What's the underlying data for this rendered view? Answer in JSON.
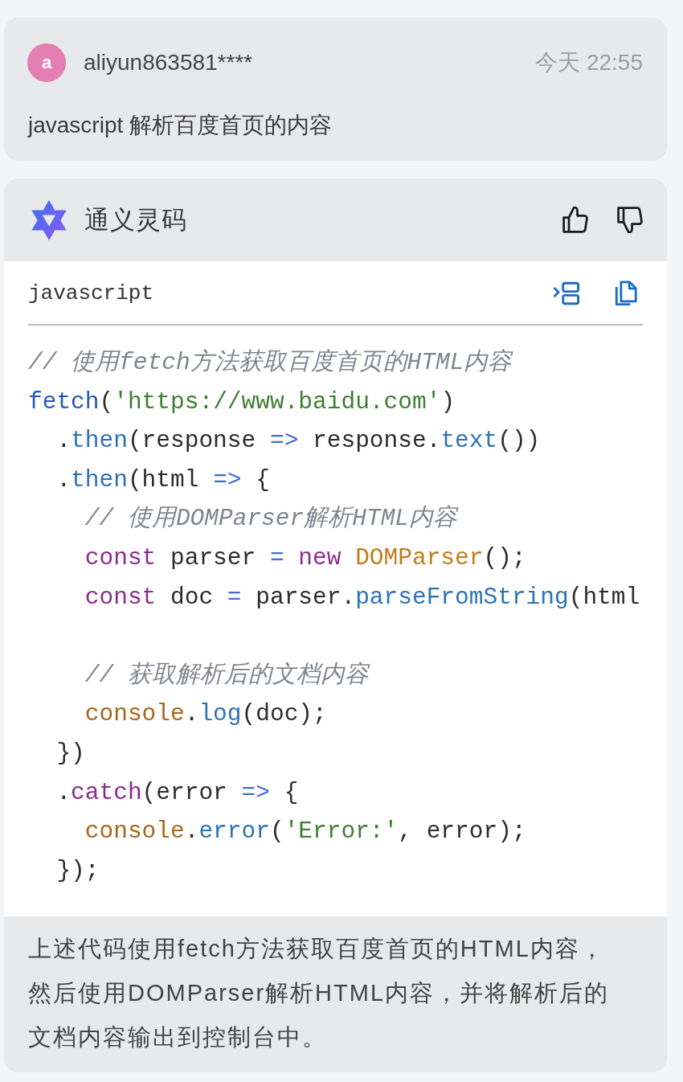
{
  "question": {
    "avatar_letter": "a",
    "username": "aliyun863581****",
    "time": "今天 22:55",
    "text": "javascript 解析百度首页的内容"
  },
  "answer": {
    "assistant_name": "通义灵码",
    "code_block": {
      "language": "javascript",
      "lines": [
        {
          "kind": "code",
          "tokens": [
            {
              "kind": "comment",
              "text": "// 使用fetch方法获取百度首页的HTML内容"
            }
          ]
        },
        {
          "kind": "code",
          "tokens": [
            {
              "kind": "function",
              "text": "fetch"
            },
            {
              "kind": "plain",
              "text": "("
            },
            {
              "kind": "string",
              "text": "'https://www.baidu.com'"
            },
            {
              "kind": "plain",
              "text": ")"
            }
          ],
          "children": [
            {
              "kind": "code",
              "tokens": [
                {
                  "kind": "plain",
                  "text": "."
                },
                {
                  "kind": "method",
                  "text": "then"
                },
                {
                  "kind": "plain",
                  "text": "(response "
                },
                {
                  "kind": "operator",
                  "text": "=>"
                },
                {
                  "kind": "plain",
                  "text": " response."
                },
                {
                  "kind": "method",
                  "text": "text"
                },
                {
                  "kind": "plain",
                  "text": "())"
                }
              ]
            },
            {
              "kind": "code",
              "tokens": [
                {
                  "kind": "plain",
                  "text": "."
                },
                {
                  "kind": "method",
                  "text": "then"
                },
                {
                  "kind": "plain",
                  "text": "(html "
                },
                {
                  "kind": "operator",
                  "text": "=>"
                },
                {
                  "kind": "plain",
                  "text": " {"
                }
              ],
              "children": [
                {
                  "kind": "code",
                  "tokens": [
                    {
                      "kind": "comment",
                      "text": "// 使用DOMParser解析HTML内容"
                    }
                  ]
                },
                {
                  "kind": "code",
                  "tokens": [
                    {
                      "kind": "keyword",
                      "text": "const"
                    },
                    {
                      "kind": "plain",
                      "text": " parser "
                    },
                    {
                      "kind": "operator",
                      "text": "="
                    },
                    {
                      "kind": "keyword",
                      "text": " new"
                    },
                    {
                      "kind": "class",
                      "text": " DOMParser"
                    },
                    {
                      "kind": "plain",
                      "text": "();"
                    }
                  ]
                },
                {
                  "kind": "code",
                  "tokens": [
                    {
                      "kind": "keyword",
                      "text": "const"
                    },
                    {
                      "kind": "plain",
                      "text": " doc "
                    },
                    {
                      "kind": "operator",
                      "text": "="
                    },
                    {
                      "kind": "plain",
                      "text": " parser."
                    },
                    {
                      "kind": "method",
                      "text": "parseFromString"
                    },
                    {
                      "kind": "plain",
                      "text": "(html"
                    }
                  ]
                },
                {
                  "kind": "blank"
                },
                {
                  "kind": "code",
                  "tokens": [
                    {
                      "kind": "comment",
                      "text": "// 获取解析后的文档内容"
                    }
                  ]
                },
                {
                  "kind": "code",
                  "tokens": [
                    {
                      "kind": "object",
                      "text": "console"
                    },
                    {
                      "kind": "plain",
                      "text": "."
                    },
                    {
                      "kind": "method",
                      "text": "log"
                    },
                    {
                      "kind": "plain",
                      "text": "(doc);"
                    }
                  ]
                }
              ]
            },
            {
              "kind": "code",
              "tokens": [
                {
                  "kind": "plain",
                  "text": "})"
                }
              ]
            },
            {
              "kind": "code",
              "tokens": [
                {
                  "kind": "plain",
                  "text": "."
                },
                {
                  "kind": "keyword",
                  "text": "catch"
                },
                {
                  "kind": "plain",
                  "text": "(error "
                },
                {
                  "kind": "operator",
                  "text": "=>"
                },
                {
                  "kind": "plain",
                  "text": " {"
                }
              ],
              "children": [
                {
                  "kind": "code",
                  "tokens": [
                    {
                      "kind": "object",
                      "text": "console"
                    },
                    {
                      "kind": "plain",
                      "text": "."
                    },
                    {
                      "kind": "method",
                      "text": "error"
                    },
                    {
                      "kind": "plain",
                      "text": "("
                    },
                    {
                      "kind": "string",
                      "text": "'Error:'"
                    },
                    {
                      "kind": "plain",
                      "text": ", error);"
                    }
                  ]
                }
              ]
            },
            {
              "kind": "code",
              "tokens": [
                {
                  "kind": "plain",
                  "text": "});"
                }
              ]
            }
          ]
        }
      ]
    },
    "summary": "上述代码使用fetch方法获取百度首页的HTML内容，然后使用DOMParser解析HTML内容，并将解析后的文档内容输出到控制台中。"
  }
}
